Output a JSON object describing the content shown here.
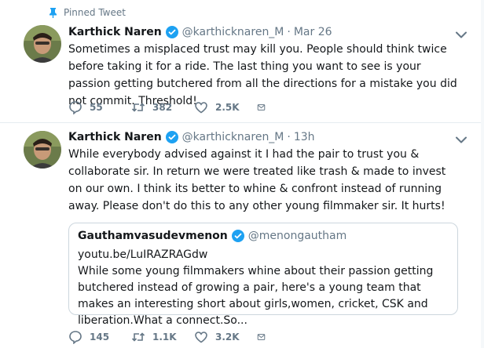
{
  "pinned_label": "Pinned Tweet",
  "tweets": [
    {
      "name": "Karthick Naren",
      "handle": "@karthicknaren_M",
      "time": "Mar 26",
      "text": "Sometimes a misplaced trust may kill you. People should think twice before taking it for a ride. The last thing you want to see is your passion getting butchered from all the directions for a mistake you did not commit. Threshold!",
      "replies": "55",
      "retweets": "382",
      "likes": "2.5K"
    },
    {
      "name": "Karthick Naren",
      "handle": "@karthicknaren_M",
      "time": "13h",
      "text": "While everybody advised against it I had the pair to trust you & collaborate sir. In return we were treated like trash & made to invest on our own. I think its better to whine & confront instead of running away. Please don't do this to any other young filmmaker sir. It hurts!",
      "replies": "145",
      "retweets": "1.1K",
      "likes": "3.2K",
      "quote": {
        "name": "Gauthamvasudevmenon",
        "handle": "@menongautham",
        "link": "youtu.be/LuIRAZRAGdw",
        "text": "While some young  filmmakers whine about their passion getting butchered instead of growing a pair, here's a young team that makes an interesting short about girls,women, cricket, CSK and liberation.What a connect.So..."
      }
    }
  ],
  "colors": {
    "verified": "#1da1f2",
    "muted": "#657786",
    "pin": "#1da1f2"
  },
  "icons": [
    "pin-icon",
    "verified-icon",
    "chevron-down-icon",
    "reply-icon",
    "retweet-icon",
    "like-icon",
    "direct-message-icon"
  ]
}
